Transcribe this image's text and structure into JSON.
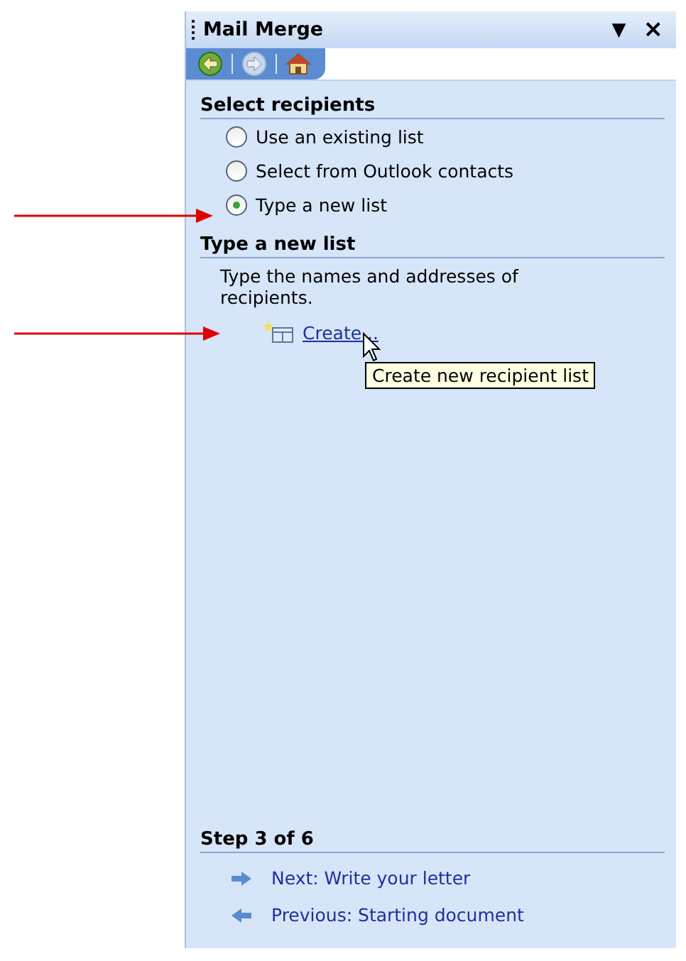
{
  "pane": {
    "title": "Mail Merge",
    "menu_glyph": "▼",
    "close_glyph": "×"
  },
  "nav": [
    {
      "kind": "back",
      "disabled": false
    },
    {
      "kind": "forward",
      "disabled": true
    },
    {
      "kind": "home",
      "disabled": false
    }
  ],
  "select_recipients": {
    "heading": "Select recipients",
    "options": [
      {
        "label": "Use an existing list",
        "selected": false
      },
      {
        "label": "Select from Outlook contacts",
        "selected": false
      },
      {
        "label": "Type a new list",
        "selected": true
      }
    ]
  },
  "type_new_list": {
    "heading": "Type a new list",
    "description": "Type the names and addresses of recipients.",
    "link": "Create...",
    "tooltip": "Create new recipient list"
  },
  "footer": {
    "step": "Step 3 of 6",
    "links": [
      {
        "kind": "next",
        "label": "Next: Write your letter"
      },
      {
        "kind": "previous",
        "label": "Previous: Starting document"
      }
    ]
  }
}
